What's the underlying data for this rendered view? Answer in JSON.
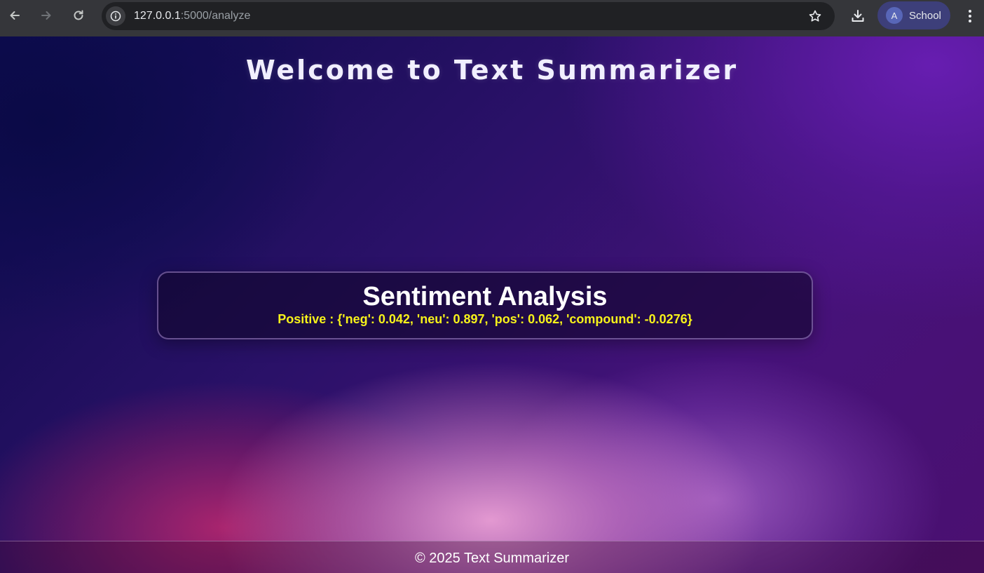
{
  "browser": {
    "url_host": "127.0.0.1",
    "url_path": ":5000/analyze",
    "profile_initial": "A",
    "profile_name": "School"
  },
  "page": {
    "title": "Welcome to Text Summarizer",
    "card_heading": "Sentiment Analysis",
    "sentiment_result": "Positive : {'neg': 0.042, 'neu': 0.897, 'pos': 0.062, 'compound': -0.0276}",
    "footer": "© 2025 Text Summarizer"
  },
  "colors": {
    "result_text": "#f7f21a",
    "title_text": "#f1efff",
    "chrome_bg": "#35363a"
  },
  "icons": [
    "back-arrow-icon",
    "forward-arrow-icon",
    "reload-icon",
    "site-info-icon",
    "bookmark-star-icon",
    "download-icon",
    "kebab-menu-icon"
  ]
}
